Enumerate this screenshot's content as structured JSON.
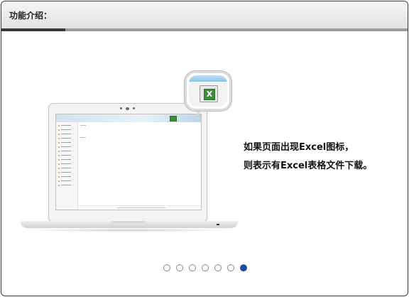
{
  "header": {
    "title": "功能介绍："
  },
  "description": {
    "line1": "如果页面出现Excel图标，",
    "line2": "则表示有Excel表格文件下载。"
  },
  "laptop": {
    "app_screen_icons": [
      "excel-icon"
    ]
  },
  "callout": {
    "icon": "excel-icon",
    "icon_glyph": "X"
  },
  "pager": {
    "total": 7,
    "active_index": 6
  },
  "colors": {
    "active_dot": "#1e4f96",
    "excel_green": "#3f8c3f",
    "header_bg": "#e8e8e8"
  }
}
